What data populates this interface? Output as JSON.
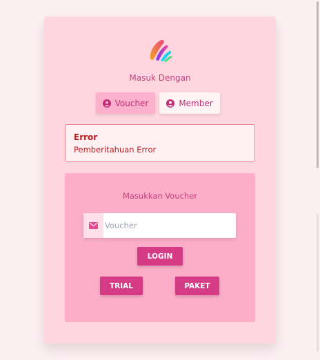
{
  "login_with": "Masuk Dengan",
  "tabs": {
    "voucher": "Voucher",
    "member": "Member"
  },
  "alert": {
    "title": "Error",
    "message": "Pemberitahuan Error"
  },
  "voucher_form": {
    "title": "Masukkan Voucher",
    "input_placeholder": "Voucher",
    "input_value": "",
    "login_label": "LOGIN",
    "trial_label": "TRIAL",
    "paket_label": "PAKET"
  },
  "icons": {
    "logo": "brush-stroke-logo",
    "tab_icon": "user-circle-icon",
    "input_icon": "envelope-icon"
  },
  "colors": {
    "primary": "#d63b86",
    "card_background": "#ffd6e0",
    "panel_background": "#fcaec8",
    "error_text": "#b91c1c"
  }
}
